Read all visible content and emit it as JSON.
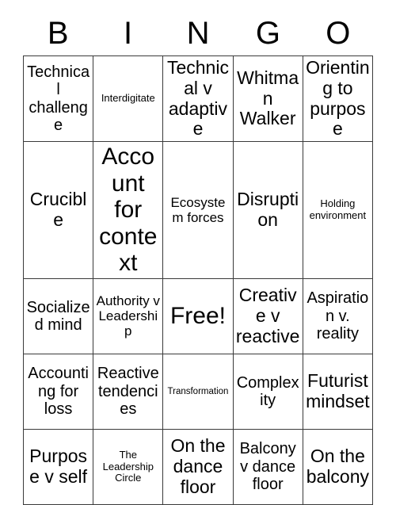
{
  "card": {
    "title": "BINGO",
    "header_letters": [
      "B",
      "I",
      "N",
      "G",
      "O"
    ],
    "columns": 5,
    "rows": 5,
    "colors": {
      "background": "#ffffff",
      "text": "#000000",
      "grid_line": "#3a3a3a"
    },
    "free_space": "Free!",
    "cells": [
      [
        {
          "label": "Technical challenge",
          "size": "lg"
        },
        {
          "label": "Interdigitate",
          "size": "sm"
        },
        {
          "label": "Technical v adaptive",
          "size": "xl"
        },
        {
          "label": "Whitman Walker",
          "size": "xl"
        },
        {
          "label": "Orienting to purpose",
          "size": "xl"
        }
      ],
      [
        {
          "label": "Crucible",
          "size": "xl"
        },
        {
          "label": "Account for context",
          "size": "xxl"
        },
        {
          "label": "Ecosystem forces",
          "size": "md"
        },
        {
          "label": "Disruption",
          "size": "xl"
        },
        {
          "label": "Holding environment",
          "size": "sm"
        }
      ],
      [
        {
          "label": "Socialized mind",
          "size": "lg"
        },
        {
          "label": "Authority v Leadership",
          "size": "md"
        },
        {
          "label": "Free!",
          "size": "xxl"
        },
        {
          "label": "Creative v reactive",
          "size": "xl"
        },
        {
          "label": "Aspiration v. reality",
          "size": "lg"
        }
      ],
      [
        {
          "label": "Accounting for loss",
          "size": "lg"
        },
        {
          "label": "Reactive tendencies",
          "size": "lg"
        },
        {
          "label": "Transformation",
          "size": "xs"
        },
        {
          "label": "Complexity",
          "size": "lg"
        },
        {
          "label": "Futurist mindset",
          "size": "xl"
        }
      ],
      [
        {
          "label": "Purpose v self",
          "size": "xl"
        },
        {
          "label": "The Leadership Circle",
          "size": "sm"
        },
        {
          "label": "On the dance floor",
          "size": "xl"
        },
        {
          "label": "Balcony v dance floor",
          "size": "lg"
        },
        {
          "label": "On the balcony",
          "size": "xl"
        }
      ]
    ]
  }
}
